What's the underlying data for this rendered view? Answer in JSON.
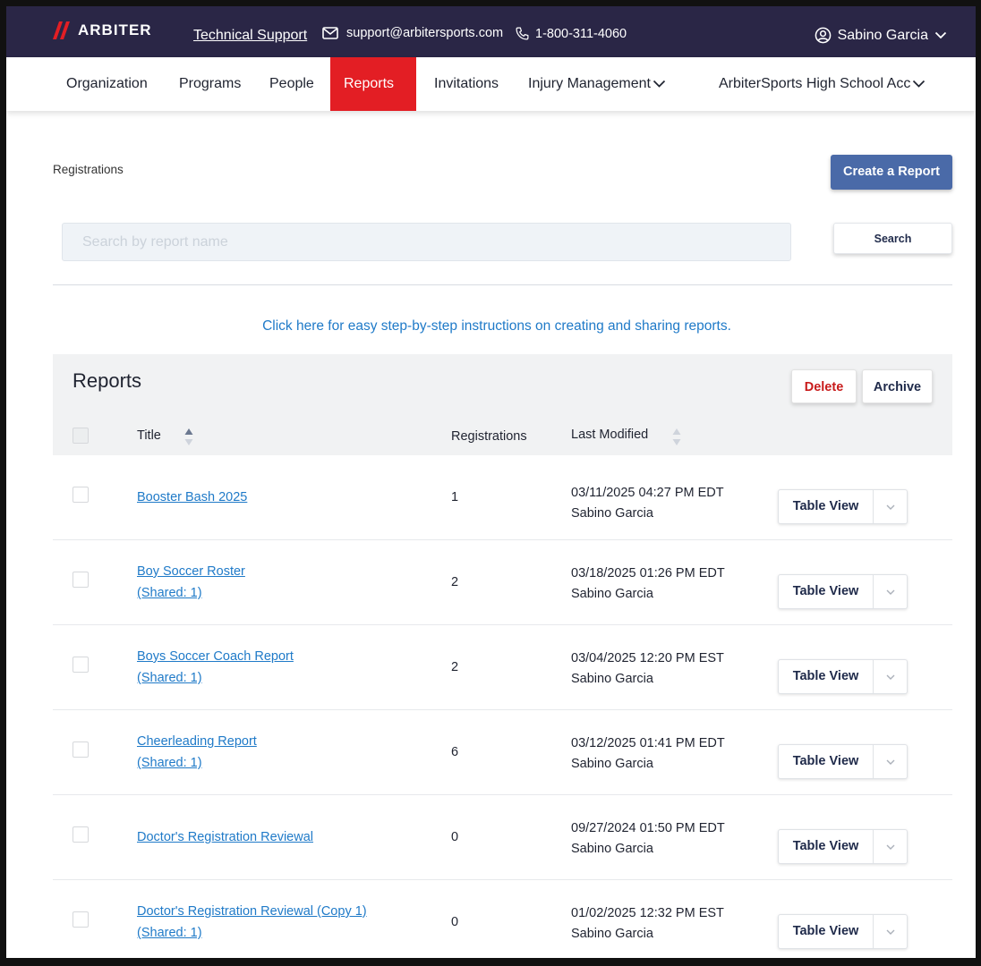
{
  "topbar": {
    "brand": "ARBITER",
    "support_label": "Technical Support",
    "email": "support@arbitersports.com",
    "phone": "1-800-311-4060",
    "user_name": "Sabino Garcia"
  },
  "nav": {
    "items": [
      {
        "label": "Organization"
      },
      {
        "label": "Programs"
      },
      {
        "label": "People"
      },
      {
        "label": "Reports"
      },
      {
        "label": "Invitations"
      },
      {
        "label": "Injury Management"
      },
      {
        "label": "ArbiterSports High School Acc"
      }
    ],
    "active": "Reports"
  },
  "page": {
    "breadcrumb": "Registrations",
    "create_button": "Create a Report",
    "search_placeholder": "Search by report name",
    "search_button": "Search",
    "help_link": "Click here for easy step-by-step instructions on creating and sharing reports."
  },
  "reports": {
    "title": "Reports",
    "delete_button": "Delete",
    "archive_button": "Archive",
    "columns": {
      "title": "Title",
      "registrations": "Registrations",
      "last_modified": "Last Modified"
    },
    "rows": [
      {
        "title": "Booster Bash 2025",
        "shared": "",
        "registrations": "1",
        "date": "03/11/2025 04:27 PM EDT",
        "user": "Sabino Garcia",
        "action": "Table View"
      },
      {
        "title": "Boy Soccer Roster",
        "shared": "(Shared: 1)",
        "registrations": "2",
        "date": "03/18/2025 01:26 PM EDT",
        "user": "Sabino Garcia",
        "action": "Table View"
      },
      {
        "title": "Boys Soccer Coach Report",
        "shared": "(Shared: 1)",
        "registrations": "2",
        "date": "03/04/2025 12:20 PM EST",
        "user": "Sabino Garcia",
        "action": "Table View"
      },
      {
        "title": "Cheerleading Report",
        "shared": "(Shared: 1)",
        "registrations": "6",
        "date": "03/12/2025 01:41 PM EDT",
        "user": "Sabino Garcia",
        "action": "Table View"
      },
      {
        "title": "Doctor's Registration Reviewal",
        "shared": "",
        "registrations": "0",
        "date": "09/27/2024 01:50 PM EDT",
        "user": "Sabino Garcia",
        "action": "Table View"
      },
      {
        "title": "Doctor's Registration Reviewal (Copy 1)",
        "shared": "(Shared: 1)",
        "registrations": "0",
        "date": "01/02/2025 12:32 PM EST",
        "user": "Sabino Garcia",
        "action": "Table View"
      }
    ]
  },
  "colors": {
    "topbar": "#2a2646",
    "active_nav": "#e31e24",
    "primary_button": "#4a6aa8",
    "link": "#1f7ac8",
    "delete": "#c81b1b"
  }
}
